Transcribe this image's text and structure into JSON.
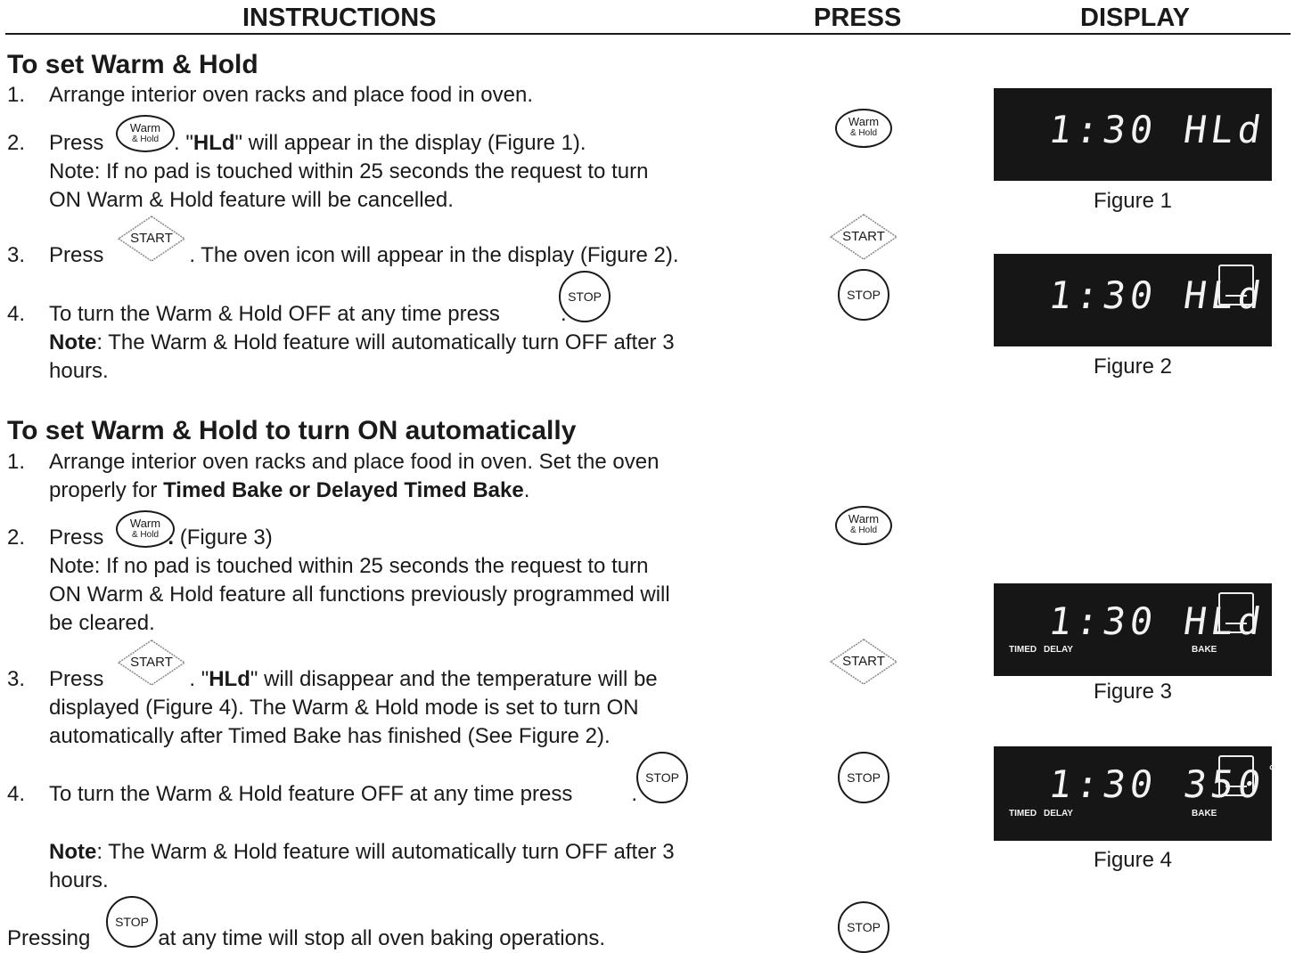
{
  "header": {
    "instructions": "INSTRUCTIONS",
    "press": "PRESS",
    "display": "DISPLAY"
  },
  "section1": {
    "title": "To set Warm & Hold",
    "step1": {
      "num": "1.",
      "text": "Arrange interior oven racks and place food in oven."
    },
    "step2": {
      "num": "2.",
      "press": "Press",
      "quote_open": ". \"",
      "hld": "HLd",
      "rest": "\" will appear in the display (Figure 1).",
      "note1": "Note: If no pad is touched within 25 seconds the request to turn",
      "note2": "ON Warm & Hold feature will be cancelled."
    },
    "step3": {
      "num": "3.",
      "press": "Press",
      "rest": ". The oven icon will appear in the display (Figure 2)."
    },
    "step4": {
      "num": "4.",
      "text": "To turn the Warm & Hold OFF at any time press",
      "end": ".",
      "note_label": "Note",
      "note_text": ": The Warm & Hold feature will automatically turn OFF after 3",
      "note_text2": "hours."
    }
  },
  "section2": {
    "title": "To set Warm & Hold to turn ON automatically",
    "step1": {
      "num": "1.",
      "text": "Arrange interior oven racks and place food in oven. Set the oven",
      "text2a": "properly for ",
      "text2b": "Timed Bake or Delayed Timed Bake",
      "text2c": "."
    },
    "step2": {
      "num": "2.",
      "press": "Press",
      "dot": ".",
      "rest": " (Figure 3)",
      "note1": "Note: If no pad is touched within 25 seconds the request to turn",
      "note2": "ON Warm & Hold feature all functions previously programmed will",
      "note3": "be cleared."
    },
    "step3": {
      "num": "3.",
      "press": "Press",
      "quote_open": ". \"",
      "hld": "HLd",
      "rest": "\" will disappear and the temperature will be",
      "line2": "displayed (Figure 4). The Warm & Hold mode is set to turn ON",
      "line3": "automatically after Timed Bake has finished (See Figure 2)."
    },
    "step4": {
      "num": "4.",
      "text": "To turn the Warm & Hold feature OFF at any time press",
      "end": ".",
      "note_label": "Note",
      "note_text": ": The Warm & Hold feature will automatically turn OFF after 3",
      "note_text2": "hours."
    },
    "footer_a": "Pressing",
    "footer_b": "at any time will stop all oven baking operations."
  },
  "pads": {
    "warm_l1": "Warm",
    "warm_l2": "& Hold",
    "start": "START",
    "stop": "STOP"
  },
  "displays": {
    "fig1": {
      "text": "1:30 HLd",
      "caption": "Figure 1"
    },
    "fig2": {
      "text": "1:30 HLd",
      "caption": "Figure 2"
    },
    "fig3": {
      "text": "1:30 HLd",
      "caption": "Figure 3",
      "timed": "TIMED",
      "delay": "DELAY",
      "bake": "BAKE"
    },
    "fig4": {
      "text": "1:30 350",
      "degree": "°",
      "caption": "Figure 4",
      "timed": "TIMED",
      "delay": "DELAY",
      "bake": "BAKE"
    }
  }
}
